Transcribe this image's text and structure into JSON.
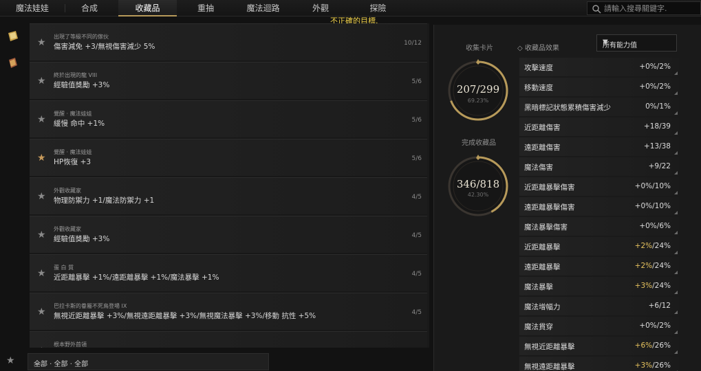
{
  "nav": {
    "tabs": [
      "魔法娃娃",
      "合成",
      "收藏品",
      "重抽",
      "魔法迴路",
      "外觀",
      "探險"
    ],
    "active_tab": "收藏品"
  },
  "search": {
    "placeholder": "請輸入搜尋關鍵字."
  },
  "warning": "不正確的目標.",
  "collections": [
    {
      "sub": "出現了等級不同的傢伙",
      "desc": "傷害減免 +3/無視傷害減少 5%",
      "count": "10/12",
      "starred": false
    },
    {
      "sub": "終於出現的龍 VIII",
      "desc": "經驗值獎勵 +3%",
      "count": "5/6",
      "starred": false
    },
    {
      "sub": "覺醒 · 魔法娃娃",
      "desc": "緩慢 命中 +1%",
      "count": "5/6",
      "starred": false
    },
    {
      "sub": "覺醒 · 魔法娃娃",
      "desc": "HP恢復 +3",
      "count": "5/6",
      "starred": true
    },
    {
      "sub": "外觀收藏家",
      "desc": "物理防禦力 +1/魔法防禦力 +1",
      "count": "4/5",
      "starred": false
    },
    {
      "sub": "外觀收藏家",
      "desc": "經驗值獎勵 +3%",
      "count": "4/5",
      "starred": false
    },
    {
      "sub": "蛋 白 質",
      "desc": "近距離暴擊 +1%/遠距離暴擊 +1%/魔法暴擊 +1%",
      "count": "4/5",
      "starred": false
    },
    {
      "sub": "巴拉卡斯的眷屬不死鳥登場 IX",
      "desc": "無視近距離暴擊 +3%/無視遠距離暴擊 +3%/無視魔法暴擊 +3%/移動 抗性 +5%",
      "count": "4/5",
      "starred": false
    },
    {
      "sub": "根本野外首領",
      "desc": "",
      "count": "",
      "starred": false
    }
  ],
  "filter": {
    "label": "全部 · 全部 · 全部"
  },
  "progress": {
    "cards_label": "收集卡片",
    "cards_value": "207/299",
    "cards_pct": "69.23%",
    "cards_fraction": 0.6923,
    "items_label": "完成收藏品",
    "items_value": "346/818",
    "items_pct": "42.30%",
    "items_fraction": 0.423
  },
  "effects": {
    "label": "收藏品效果",
    "dropdown_value": "所有能力值",
    "stats": [
      {
        "name": "攻擊速度",
        "val": "+0%",
        "max": "/2%",
        "up": false
      },
      {
        "name": "移動速度",
        "val": "+0%",
        "max": "/2%",
        "up": false
      },
      {
        "name": "黑暗標記狀態累積傷害減少",
        "val": "0%",
        "max": "/1%",
        "up": false
      },
      {
        "name": "近距離傷害",
        "val": "+18",
        "max": "/39",
        "up": false
      },
      {
        "name": "遠距離傷害",
        "val": "+13",
        "max": "/38",
        "up": false
      },
      {
        "name": "魔法傷害",
        "val": "+9",
        "max": "/22",
        "up": false
      },
      {
        "name": "近距離暴擊傷害",
        "val": "+0%",
        "max": "/10%",
        "up": false
      },
      {
        "name": "遠距離暴擊傷害",
        "val": "+0%",
        "max": "/10%",
        "up": false
      },
      {
        "name": "魔法暴擊傷害",
        "val": "+0%",
        "max": "/6%",
        "up": false
      },
      {
        "name": "近距離暴擊",
        "val": "+2%",
        "max": "/24%",
        "up": true
      },
      {
        "name": "遠距離暴擊",
        "val": "+2%",
        "max": "/24%",
        "up": true
      },
      {
        "name": "魔法暴擊",
        "val": "+3%",
        "max": "/24%",
        "up": true
      },
      {
        "name": "魔法增幅力",
        "val": "+6",
        "max": "/12",
        "up": false
      },
      {
        "name": "魔法貫穿",
        "val": "+0%",
        "max": "/2%",
        "up": false
      },
      {
        "name": "無視近距離暴擊",
        "val": "+6%",
        "max": "/26%",
        "up": true
      },
      {
        "name": "無視遠距離暴擊",
        "val": "+3%",
        "max": "/26%",
        "up": true
      }
    ]
  },
  "colors": {
    "accent": "#b79a5a",
    "warning": "#f1d24a",
    "highlight": "#e7c35e"
  }
}
